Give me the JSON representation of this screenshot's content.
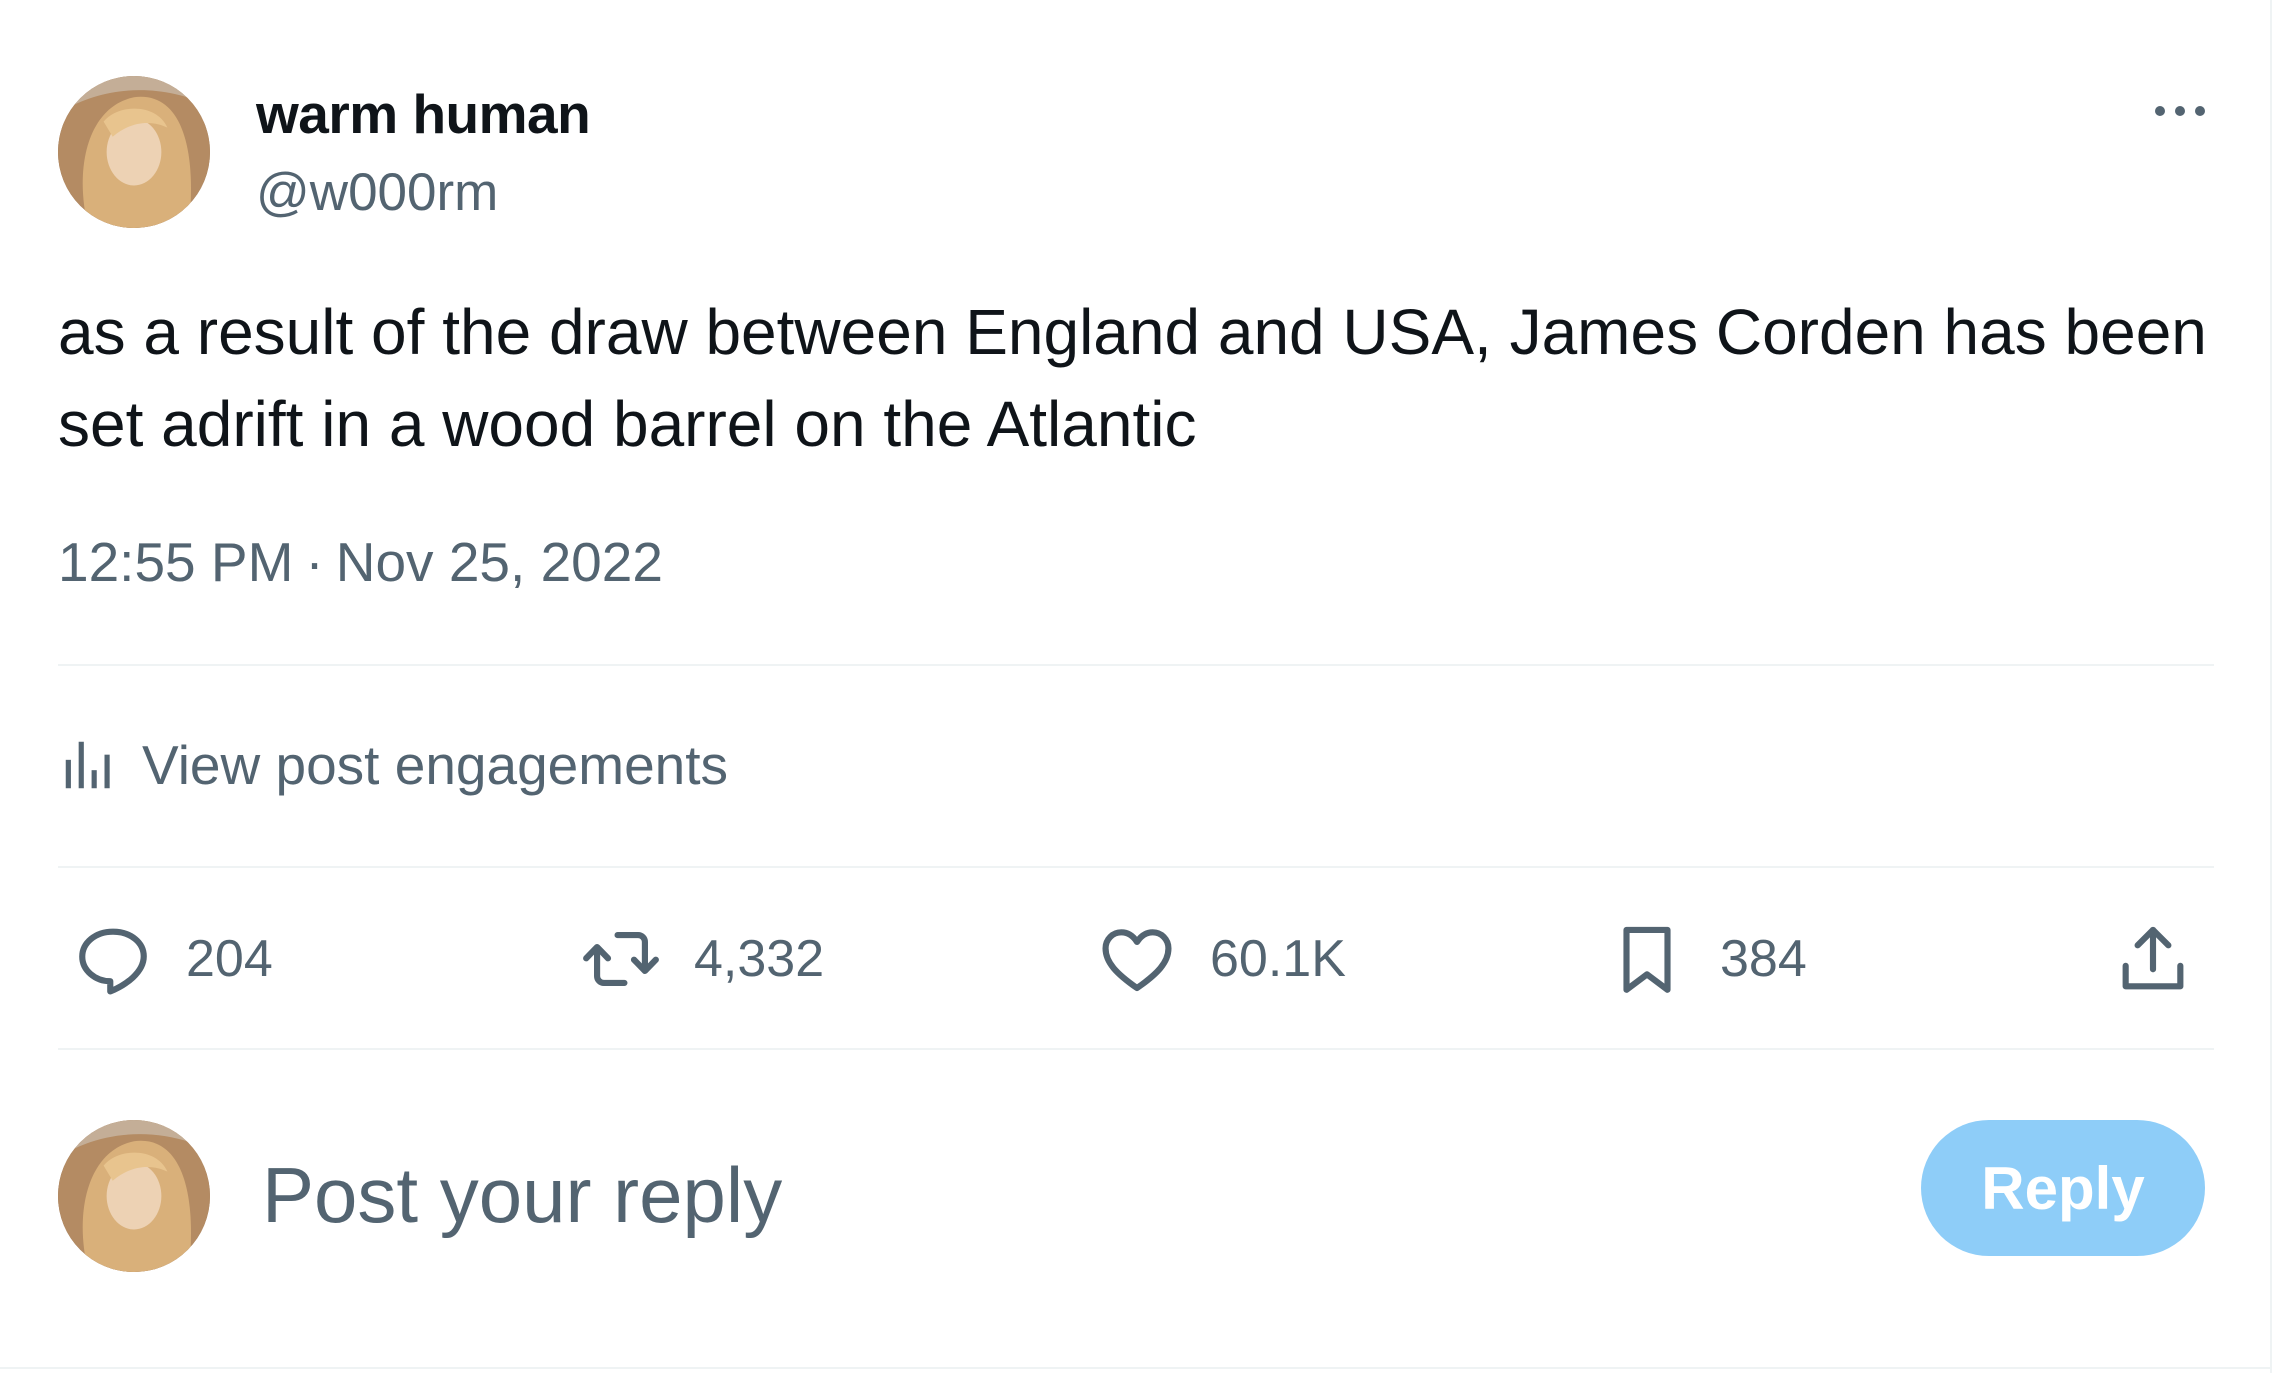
{
  "author": {
    "display_name": "warm human",
    "handle": "@w000rm",
    "avatar_icon": "user-avatar-photo"
  },
  "more_icon": "more-horizontal-icon",
  "tweet": {
    "text": "as a result of the draw between England and USA, James Corden has been set adrift in a wood barrel on the Atlantic",
    "time": "12:55 PM",
    "separator": "·",
    "date": "Nov 25, 2022"
  },
  "engagements": {
    "icon": "analytics-icon",
    "label": "View post engagements"
  },
  "actions": {
    "replies": {
      "icon": "reply-bubble-icon",
      "count": "204"
    },
    "reposts": {
      "icon": "repost-icon",
      "count": "4,332"
    },
    "likes": {
      "icon": "heart-icon",
      "count": "60.1K"
    },
    "bookmarks": {
      "icon": "bookmark-icon",
      "count": "384"
    },
    "share": {
      "icon": "share-upload-icon"
    }
  },
  "composer": {
    "placeholder": "Post your reply",
    "button_label": "Reply"
  },
  "colors": {
    "text_primary": "#0f1419",
    "text_secondary": "#536471",
    "divider": "#eff3f4",
    "reply_button_disabled": "#8ecdf8"
  }
}
